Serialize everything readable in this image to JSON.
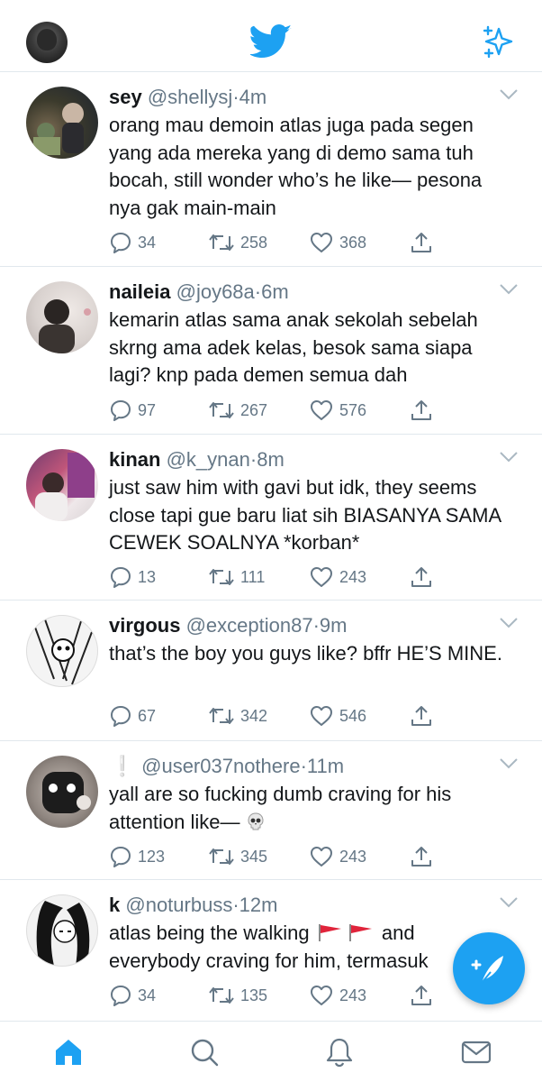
{
  "colors": {
    "accent": "#1da1f2",
    "muted": "#657786",
    "divider": "#e1e8ed",
    "text": "#14171a"
  },
  "header": {
    "logo_icon": "twitter-bird-icon",
    "sparkle_icon": "sparkle-icon"
  },
  "tweets": [
    {
      "name": "sey",
      "handle": "@shellysj",
      "dot": "·",
      "time": "4m",
      "text": "orang mau demoin atlas juga pada segen yang ada mereka yang di demo sama tuh bocah, still wonder who’s he like— pesona nya gak main-main",
      "replies": "34",
      "retweets": "258",
      "likes": "368"
    },
    {
      "name": "naileia",
      "handle": "@joy68a",
      "dot": "·",
      "time": "6m",
      "text": "kemarin atlas sama anak sekolah sebelah skrng ama adek kelas, besok sama siapa lagi? knp pada demen semua dah",
      "replies": "97",
      "retweets": "267",
      "likes": "576"
    },
    {
      "name": "kinan",
      "handle": "@k_ynan",
      "dot": "·",
      "time": "8m",
      "text": "just saw him with gavi but idk, they seems close tapi gue baru liat sih BIASANYA SAMA CEWEK SOALNYA *korban*",
      "replies": "13",
      "retweets": "111",
      "likes": "243"
    },
    {
      "name": "virgous",
      "handle": "@exception87",
      "dot": "·",
      "time": "9m",
      "text": "that’s the boy you guys like? bffr HE’S MINE.",
      "replies": "67",
      "retweets": "342",
      "likes": "546"
    },
    {
      "name": "❕",
      "handle": "@user037nothere",
      "dot": "·",
      "time": "11m",
      "text": " yall are so fucking dumb craving for his attention like—",
      "replies": "123",
      "retweets": "345",
      "likes": "243"
    },
    {
      "name": "k",
      "handle": "@noturbuss",
      "dot": "·",
      "time": "12m",
      "text_a": "atlas being the walking",
      "text_b": "and everybody craving for him, termasuk",
      "replies": "34",
      "retweets": "135",
      "likes": "243"
    }
  ],
  "tabs": [
    "home-icon",
    "search-icon",
    "notifications-icon",
    "messages-icon"
  ]
}
